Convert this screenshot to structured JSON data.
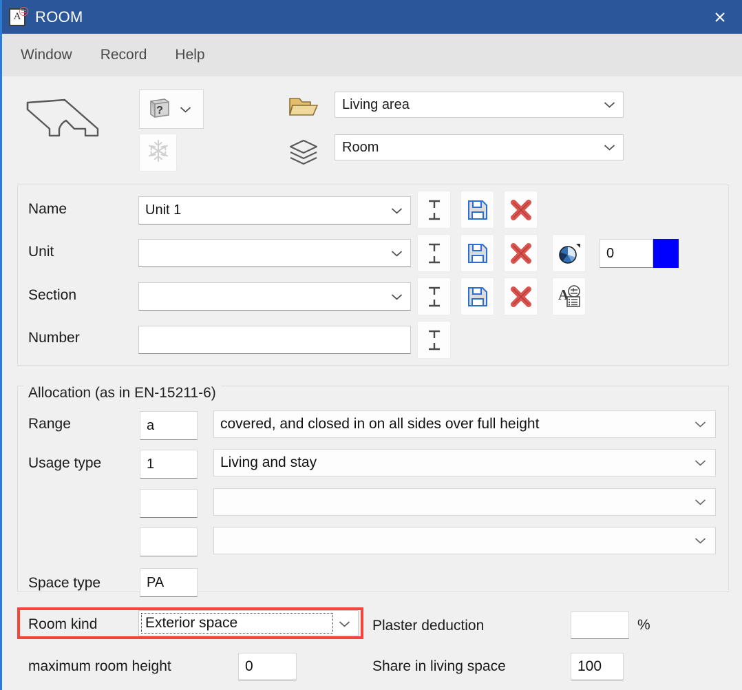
{
  "window": {
    "title": "ROOM",
    "close_label": "✕",
    "app_icon_letter": "A",
    "accent_color": "#2b579a",
    "frame_accent": "#2b7cd3"
  },
  "menubar": {
    "items": [
      {
        "label": "Window"
      },
      {
        "label": "Record"
      },
      {
        "label": "Help"
      }
    ]
  },
  "toolbar": {
    "slab_icon": "slab-3d-icon",
    "book_button": {
      "icon": "book-question-icon",
      "chevron": "chevron-down-icon"
    },
    "freeze_button": {
      "icon": "snowflake-icon",
      "enabled": false
    },
    "folder_icon": "folder-open-icon",
    "layers_icon": "layers-stack-icon",
    "selects": [
      {
        "name": "area-select",
        "value": "Living area"
      },
      {
        "name": "category-select",
        "value": "Room"
      }
    ]
  },
  "identity": {
    "rows": [
      {
        "label": "Name",
        "value": "Unit 1",
        "combo": true,
        "buttons": [
          "text-style-icon",
          "save-icon",
          "delete-icon"
        ]
      },
      {
        "label": "Unit",
        "value": "",
        "combo": true,
        "buttons": [
          "text-style-icon",
          "save-icon",
          "delete-icon",
          "color-wheel-icon"
        ]
      },
      {
        "label": "Section",
        "value": "",
        "combo": true,
        "buttons": [
          "text-style-icon",
          "save-icon",
          "delete-icon",
          "text-attributes-icon"
        ]
      },
      {
        "label": "Number",
        "value": "",
        "combo": false,
        "buttons": [
          "text-style-icon"
        ]
      }
    ],
    "color_value": "0",
    "color_swatch": "#0000ff"
  },
  "allocation": {
    "legend": "Allocation (as in EN-15211-6)",
    "rows": [
      {
        "label": "Range",
        "code": "a",
        "description": "covered, and closed in on all sides over full height"
      },
      {
        "label": "Usage type",
        "code": "1",
        "description": "Living and stay"
      },
      {
        "label": "",
        "code": "",
        "description": ""
      },
      {
        "label": "",
        "code": "",
        "description": ""
      }
    ],
    "space_type": {
      "label": "Space type",
      "value": "PA"
    }
  },
  "bottom": {
    "room_kind": {
      "label": "Room kind",
      "value": "Exterior space",
      "highlight_color": "#f4443c"
    },
    "max_room_height": {
      "label": "maximum room height",
      "value": "0"
    },
    "plaster_deduction": {
      "label": "Plaster deduction",
      "value": "",
      "unit": "%"
    },
    "share_in_living_space": {
      "label": "Share in living space",
      "value": "100"
    }
  }
}
